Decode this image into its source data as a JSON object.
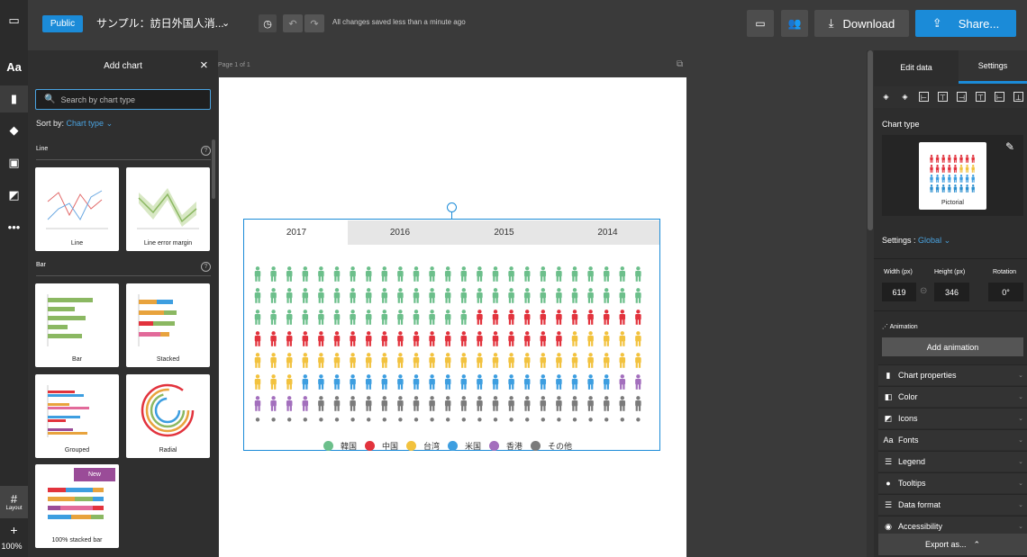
{
  "topbar": {
    "public_label": "Public",
    "project_title": "サンプル：訪日外国人消...",
    "save_status": "All changes saved less than a minute ago",
    "download_label": "Download",
    "share_label": "Share..."
  },
  "left_panel": {
    "title": "Add chart",
    "search_placeholder": "Search by chart type",
    "sort_by_label": "Sort by:",
    "sort_value": "Chart type",
    "sections": [
      {
        "name": "Line",
        "items": [
          "Line",
          "Line error margin"
        ]
      },
      {
        "name": "Bar",
        "items": [
          "Bar",
          "Stacked",
          "Grouped",
          "Radial",
          "100% stacked bar"
        ]
      }
    ],
    "new_badge": "New"
  },
  "rail": {
    "layout_label": "Layout",
    "zoom": "100%"
  },
  "canvas": {
    "page_label": "Page 1 of 1"
  },
  "chart_data": {
    "type": "pictorial",
    "tabs": [
      "2017",
      "2016",
      "2015",
      "2014"
    ],
    "active_tab": "2017",
    "columns": 25,
    "series": [
      {
        "name": "韓国",
        "color": "#6cbf8b",
        "count": 64
      },
      {
        "name": "中国",
        "color": "#e2333d",
        "count": 31
      },
      {
        "name": "台湾",
        "color": "#f2c23e",
        "count": 33
      },
      {
        "name": "米国",
        "color": "#3d9ee0",
        "count": 20
      },
      {
        "name": "香港",
        "color": "#a36fbd",
        "count": 6
      },
      {
        "name": "その他",
        "color": "#7b7b7b",
        "count": 46
      }
    ]
  },
  "right_panel": {
    "tab_edit": "Edit data",
    "tab_settings": "Settings",
    "chart_type_label": "Chart type",
    "chart_type_value": "Pictorial",
    "settings_label": "Settings :",
    "settings_scope": "Global",
    "width_label": "Width (px)",
    "height_label": "Height (px)",
    "rotation_label": "Rotation",
    "width_value": "619",
    "height_value": "346",
    "rotation_value": "0°",
    "animation_label": "Animation",
    "add_animation": "Add animation",
    "sections": [
      "Chart properties",
      "Color",
      "Icons",
      "Fonts",
      "Legend",
      "Tooltips",
      "Data format",
      "Accessibility"
    ],
    "export_label": "Export as..."
  }
}
